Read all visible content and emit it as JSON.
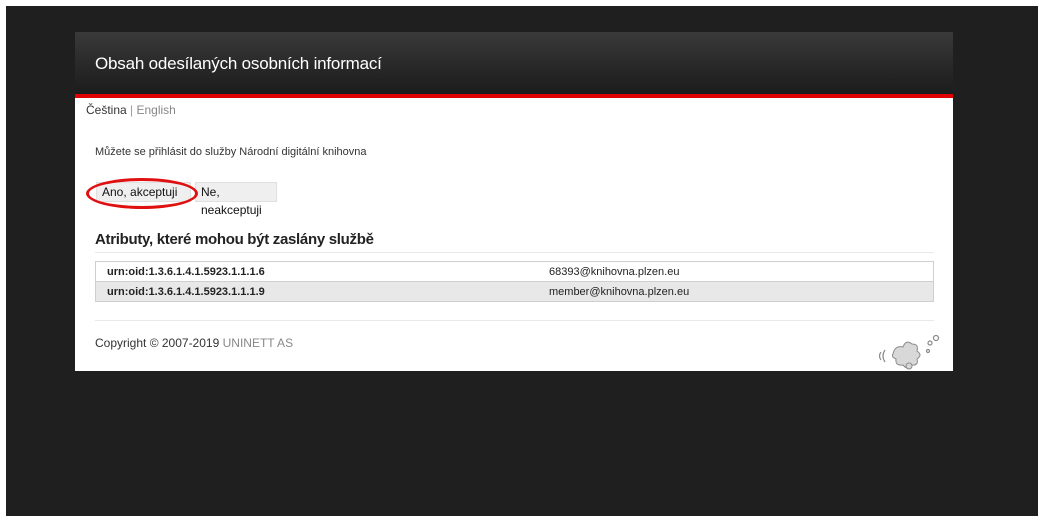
{
  "header": {
    "title": "Obsah odesílaných osobních informací"
  },
  "language_bar": {
    "current": "Čeština",
    "separator": "|",
    "other": "English"
  },
  "consent": {
    "intro_text": "Můžete se přihlásit do služby Národní digitální knihovna",
    "accept_label": "Ano, akceptuji",
    "decline_label": "Ne, neakceptuji"
  },
  "attributes": {
    "heading": "Atributy, které mohou být zaslány službě",
    "rows": [
      {
        "name": "urn:oid:1.3.6.1.4.1.5923.1.1.1.6",
        "value": "68393@knihovna.plzen.eu"
      },
      {
        "name": "urn:oid:1.3.6.1.4.1.5923.1.1.1.9",
        "value": "member@knihovna.plzen.eu"
      }
    ]
  },
  "footer": {
    "copyright_prefix": "Copyright © 2007-2019",
    "copyright_org": "UNINETT AS",
    "logo_icon": "simplesamlphp-logo-icon"
  },
  "colors": {
    "accent_red": "#e00000",
    "header_dark": "#2a2a2a",
    "page_background": "#1f1f1f",
    "annotation_circle": "#e01010"
  }
}
